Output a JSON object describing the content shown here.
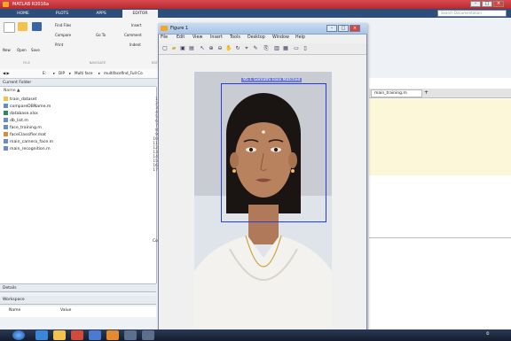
{
  "app": {
    "title": "MATLAB R2016a"
  },
  "tabs": [
    "HOME",
    "PLOTS",
    "APPS",
    "EDITOR"
  ],
  "search": {
    "placeholder": "Search Documentation"
  },
  "ribbon": {
    "new": "New",
    "open": "Open",
    "save": "Save",
    "find_files": "Find Files",
    "compare": "Compare",
    "print": "Print",
    "go_to": "Go To",
    "comment": "Comment",
    "indent": "Indent",
    "insert": "Insert",
    "sections": [
      "FILE",
      "NAVIGATE",
      "EDIT"
    ]
  },
  "address": {
    "path": [
      "E:",
      "DIP",
      "Multi face",
      "multifacefind_Full Co"
    ]
  },
  "current_folder": {
    "title": "Current Folder",
    "column": "Name",
    "files": [
      "train_dataset",
      "compareDBName.m",
      "database.xlsx",
      "db_list.m",
      "face_training.m",
      "faceClassifier.mat",
      "main_camera_face.m",
      "main_recognition.m"
    ]
  },
  "line_numbers": [
    "1",
    "2",
    "3",
    "4",
    "5",
    "6",
    "7",
    "8",
    "9",
    "10",
    "11",
    "12",
    "13",
    "14",
    "15",
    "16",
    "17"
  ],
  "details": {
    "title": "Details"
  },
  "workspace": {
    "title": "Workspace",
    "col_name": "Name",
    "col_value": "Value",
    "com_label": "Com"
  },
  "figure": {
    "title": "Figure 1",
    "menu": [
      "File",
      "Edit",
      "View",
      "Insert",
      "Tools",
      "Desktop",
      "Window",
      "Help"
    ],
    "detection_label": "95.1 Gomathi Face Matched"
  },
  "editor": {
    "tab": "main_training.m"
  },
  "colors": {
    "titlebar": "#c7343a",
    "tabstrip": "#2d4e7a",
    "detect_box": "#2a3cd8"
  }
}
